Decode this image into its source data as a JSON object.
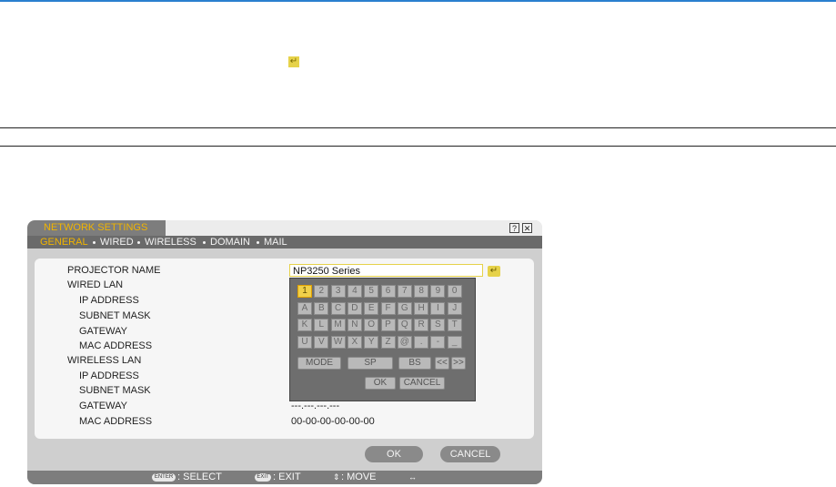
{
  "dialog": {
    "title": "NETWORK SETTINGS",
    "help_icon": "?",
    "close_icon": "✕",
    "tabs": [
      "GENERAL",
      "WIRED",
      "WIRELESS",
      "DOMAIN",
      "MAIL"
    ],
    "labels": {
      "projector_name": "PROJECTOR NAME",
      "wired_lan": "WIRED LAN",
      "ip_address": "IP ADDRESS",
      "subnet_mask": "SUBNET MASK",
      "gateway": "GATEWAY",
      "mac_address": "MAC ADDRESS",
      "wireless_lan": "WIRELESS LAN"
    },
    "projector_name_value": "NP3250 Series",
    "wireless_gateway_value": "---.---.---.---",
    "wireless_mac_value": "00-00-00-00-00-00",
    "ok_label": "OK",
    "cancel_label": "CANCEL"
  },
  "keyboard": {
    "rows": [
      [
        "1",
        "2",
        "3",
        "4",
        "5",
        "6",
        "7",
        "8",
        "9",
        "0"
      ],
      [
        "A",
        "B",
        "C",
        "D",
        "E",
        "F",
        "G",
        "H",
        "I",
        "J"
      ],
      [
        "K",
        "L",
        "M",
        "N",
        "O",
        "P",
        "Q",
        "R",
        "S",
        "T"
      ],
      [
        "U",
        "V",
        "W",
        "X",
        "Y",
        "Z",
        "@",
        ".",
        "-",
        "_"
      ]
    ],
    "selected": "1",
    "mode_label": "MODE",
    "sp_label": "SP",
    "bs_label": "BS",
    "left_label": "<<",
    "right_label": ">>",
    "ok_label": "OK",
    "cancel_label": "CANCEL"
  },
  "footer": {
    "enter_key": "ENTER",
    "select_label": ": SELECT",
    "exit_key": "EXIT",
    "exit_label": ": EXIT",
    "move_label": ": MOVE"
  },
  "icons": {
    "enter": "↵",
    "updown": "⇕",
    "leftright": "↔"
  },
  "colors": {
    "accent": "#f0b400",
    "tab_bar": "#6a6a6a",
    "dialog_bg": "#cfcfcf",
    "top_rule": "#2a7fcf"
  }
}
